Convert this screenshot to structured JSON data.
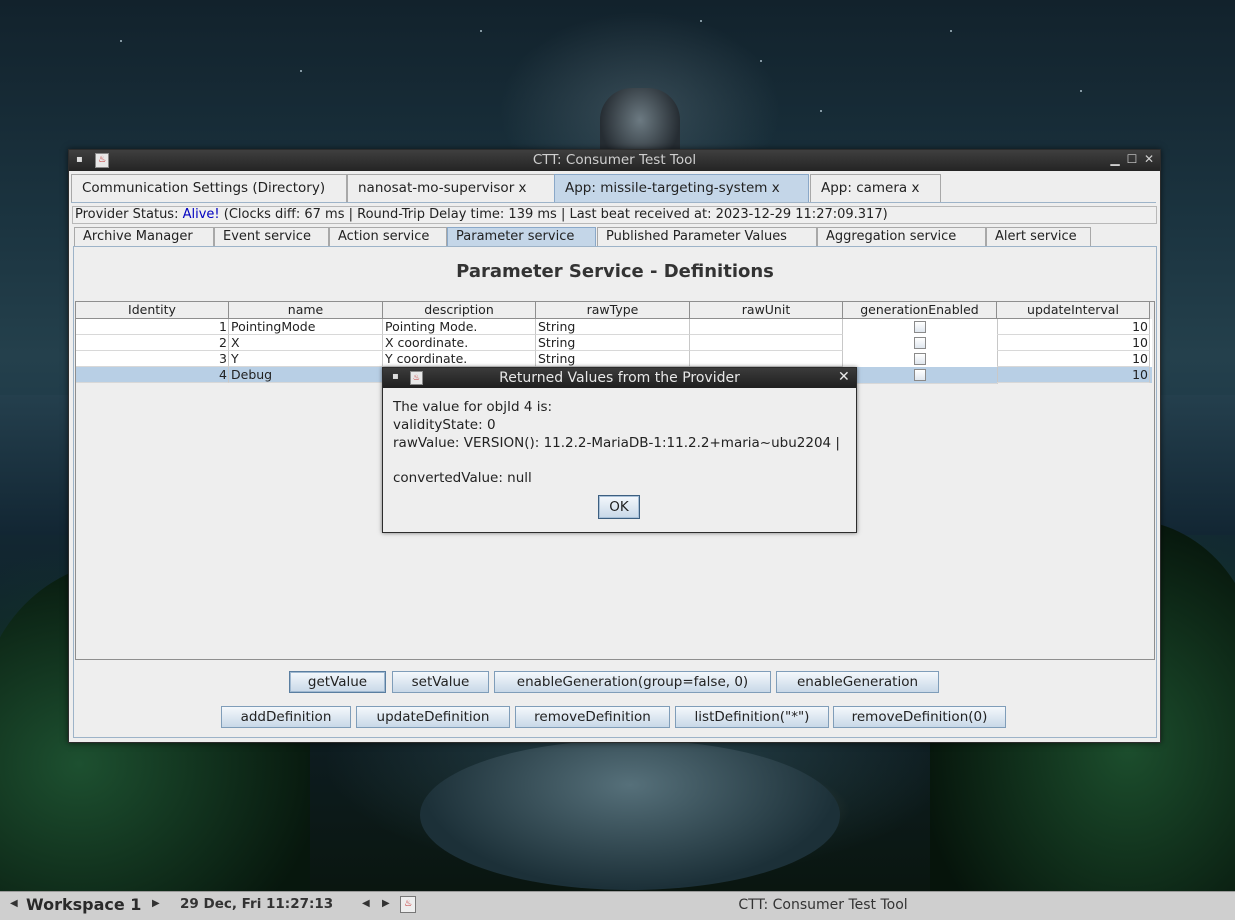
{
  "window": {
    "title": "CTT: Consumer Test Tool",
    "menu_glyph": "▪",
    "minimize_glyph": "▁",
    "maximize_glyph": "☐",
    "close_glyph": "✕"
  },
  "top_tabs": [
    {
      "label": "Communication Settings (Directory)",
      "active": false
    },
    {
      "label": "nanosat-mo-supervisor x",
      "active": false
    },
    {
      "label": "App: missile-targeting-system x",
      "active": true
    },
    {
      "label": "App: camera x",
      "active": false
    }
  ],
  "status": {
    "prefix": "Provider Status: ",
    "alive": "Alive!",
    "details": " (Clocks diff: 67 ms | Round-Trip Delay time: 139 ms | Last beat received at: 2023-12-29 11:27:09.317)"
  },
  "sub_tabs": [
    {
      "label": "Archive Manager",
      "active": false
    },
    {
      "label": "Event service",
      "active": false
    },
    {
      "label": "Action service",
      "active": false
    },
    {
      "label": "Parameter service",
      "active": true
    },
    {
      "label": "Published Parameter Values",
      "active": false
    },
    {
      "label": "Aggregation service",
      "active": false
    },
    {
      "label": "Alert service",
      "active": false
    }
  ],
  "panel": {
    "title": "Parameter Service - Definitions"
  },
  "table": {
    "columns": [
      "Identity",
      "name",
      "description",
      "rawType",
      "rawUnit",
      "generationEnabled",
      "updateInterval"
    ],
    "rows": [
      {
        "identity": "1",
        "name": "PointingMode",
        "description": "Pointing Mode.",
        "rawType": "String",
        "rawUnit": "",
        "generationEnabled": false,
        "updateInterval": "10",
        "selected": false
      },
      {
        "identity": "2",
        "name": "X",
        "description": "X coordinate.",
        "rawType": "String",
        "rawUnit": "",
        "generationEnabled": false,
        "updateInterval": "10",
        "selected": false
      },
      {
        "identity": "3",
        "name": "Y",
        "description": "Y coordinate.",
        "rawType": "String",
        "rawUnit": "",
        "generationEnabled": false,
        "updateInterval": "10",
        "selected": false
      },
      {
        "identity": "4",
        "name": "Debug",
        "description": "",
        "rawType": "",
        "rawUnit": "",
        "generationEnabled": false,
        "updateInterval": "10",
        "selected": true
      }
    ]
  },
  "buttons": {
    "row1": [
      "getValue",
      "setValue",
      "enableGeneration(group=false, 0)",
      "enableGeneration"
    ],
    "row2": [
      "addDefinition",
      "updateDefinition",
      "removeDefinition",
      "listDefinition(\"*\")",
      "removeDefinition(0)"
    ]
  },
  "dialog": {
    "title": "Returned Values from the Provider",
    "close_glyph": "✕",
    "lines": [
      "The value for objId 4 is:",
      "validityState: 0",
      "rawValue: VERSION(): 11.2.2-MariaDB-1:11.2.2+maria~ubu2204 |",
      "convertedValue: null"
    ],
    "ok_label": "OK"
  },
  "taskbar": {
    "workspace": "Workspace 1",
    "clock": "29 Dec, Fri 11:27:13",
    "task_label": "CTT: Consumer Test Tool",
    "left_arrow": "◀",
    "right_arrow": "▶"
  }
}
